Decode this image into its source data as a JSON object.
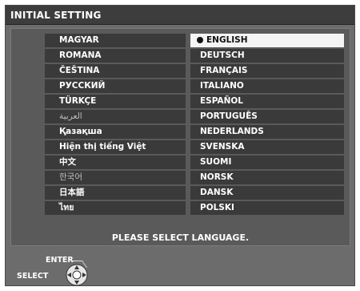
{
  "title": "INITIAL SETTING",
  "languages_left": [
    "MAGYAR",
    "ROMANA",
    "ČEŠTINA",
    "РУССКИЙ",
    "TÜRKÇE",
    "العربية",
    "Қазақша",
    "Hiện thị tiếng Việt",
    "中文",
    "한국어",
    "日本語",
    "ไทย"
  ],
  "languages_right": [
    "ENGLISH",
    "DEUTSCH",
    "FRANÇAIS",
    "ITALIANO",
    "ESPAÑOL",
    "PORTUGUÊS",
    "NEDERLANDS",
    "SVENSKA",
    "SUOMI",
    "NORSK",
    "DANSK",
    "POLSKI"
  ],
  "selected_language": "ENGLISH",
  "prompt": "PLEASE SELECT LANGUAGE.",
  "footer": {
    "enter_label": "ENTER",
    "select_label": "SELECT",
    "icon": "dpad-icon"
  },
  "colors": {
    "panel": "#6c6c6c",
    "titlebar": "#3d3d3d",
    "row": "#3a3a3a",
    "selected_row": "#f4f4f4"
  }
}
